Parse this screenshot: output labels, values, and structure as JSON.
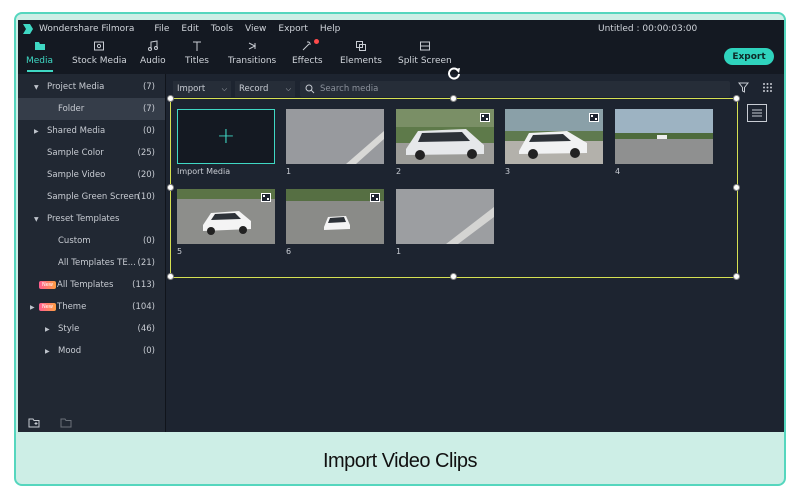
{
  "app": {
    "name": "Wondershare Filmora",
    "title": "Untitled : 00:00:03:00",
    "menu": [
      "File",
      "Edit",
      "Tools",
      "View",
      "Export",
      "Help"
    ]
  },
  "toolbar": {
    "tabs": [
      {
        "label": "Media",
        "icon": "folder-icon"
      },
      {
        "label": "Stock Media",
        "icon": "stock-media-icon"
      },
      {
        "label": "Audio",
        "icon": "music-icon"
      },
      {
        "label": "Titles",
        "icon": "text-icon"
      },
      {
        "label": "Transitions",
        "icon": "transition-icon"
      },
      {
        "label": "Effects",
        "icon": "effects-icon"
      },
      {
        "label": "Elements",
        "icon": "elements-icon"
      },
      {
        "label": "Split Screen",
        "icon": "split-screen-icon"
      }
    ],
    "export_label": "Export"
  },
  "sidebar": {
    "items": [
      {
        "label": "Project Media",
        "count": "(7)",
        "arrow": "down"
      },
      {
        "label": "Folder",
        "count": "(7)",
        "selected": true
      },
      {
        "label": "Shared Media",
        "count": "(0)",
        "arrow": "right"
      },
      {
        "label": "Sample Color",
        "count": "(25)"
      },
      {
        "label": "Sample Video",
        "count": "(20)"
      },
      {
        "label": "Sample Green Screen",
        "count": "(10)"
      },
      {
        "label": "Preset Templates",
        "count": "",
        "arrow": "down"
      },
      {
        "label": "Custom",
        "count": "(0)"
      },
      {
        "label": "All Templates TE...",
        "count": "(21)"
      },
      {
        "label": "All Templates",
        "count": "(113)",
        "badge": "New"
      },
      {
        "label": "Theme",
        "count": "(104)",
        "badge": "New",
        "arrow": "right"
      },
      {
        "label": "Style",
        "count": "(46)",
        "arrow": "right"
      },
      {
        "label": "Mood",
        "count": "(0)",
        "arrow": "right"
      }
    ]
  },
  "media_bar": {
    "import_label": "Import",
    "record_label": "Record",
    "search_placeholder": "Search media"
  },
  "media": {
    "import_label": "Import Media",
    "clips": [
      {
        "label": "1"
      },
      {
        "label": "2"
      },
      {
        "label": "3"
      },
      {
        "label": "4"
      },
      {
        "label": "5"
      },
      {
        "label": "6"
      },
      {
        "label": "1"
      }
    ]
  },
  "caption": "Import Video Clips",
  "colors": {
    "accent": "#3fd8c4",
    "frame_border": "#55d6be",
    "caption_bg": "#cdeee6",
    "selection": "#d6e052"
  }
}
